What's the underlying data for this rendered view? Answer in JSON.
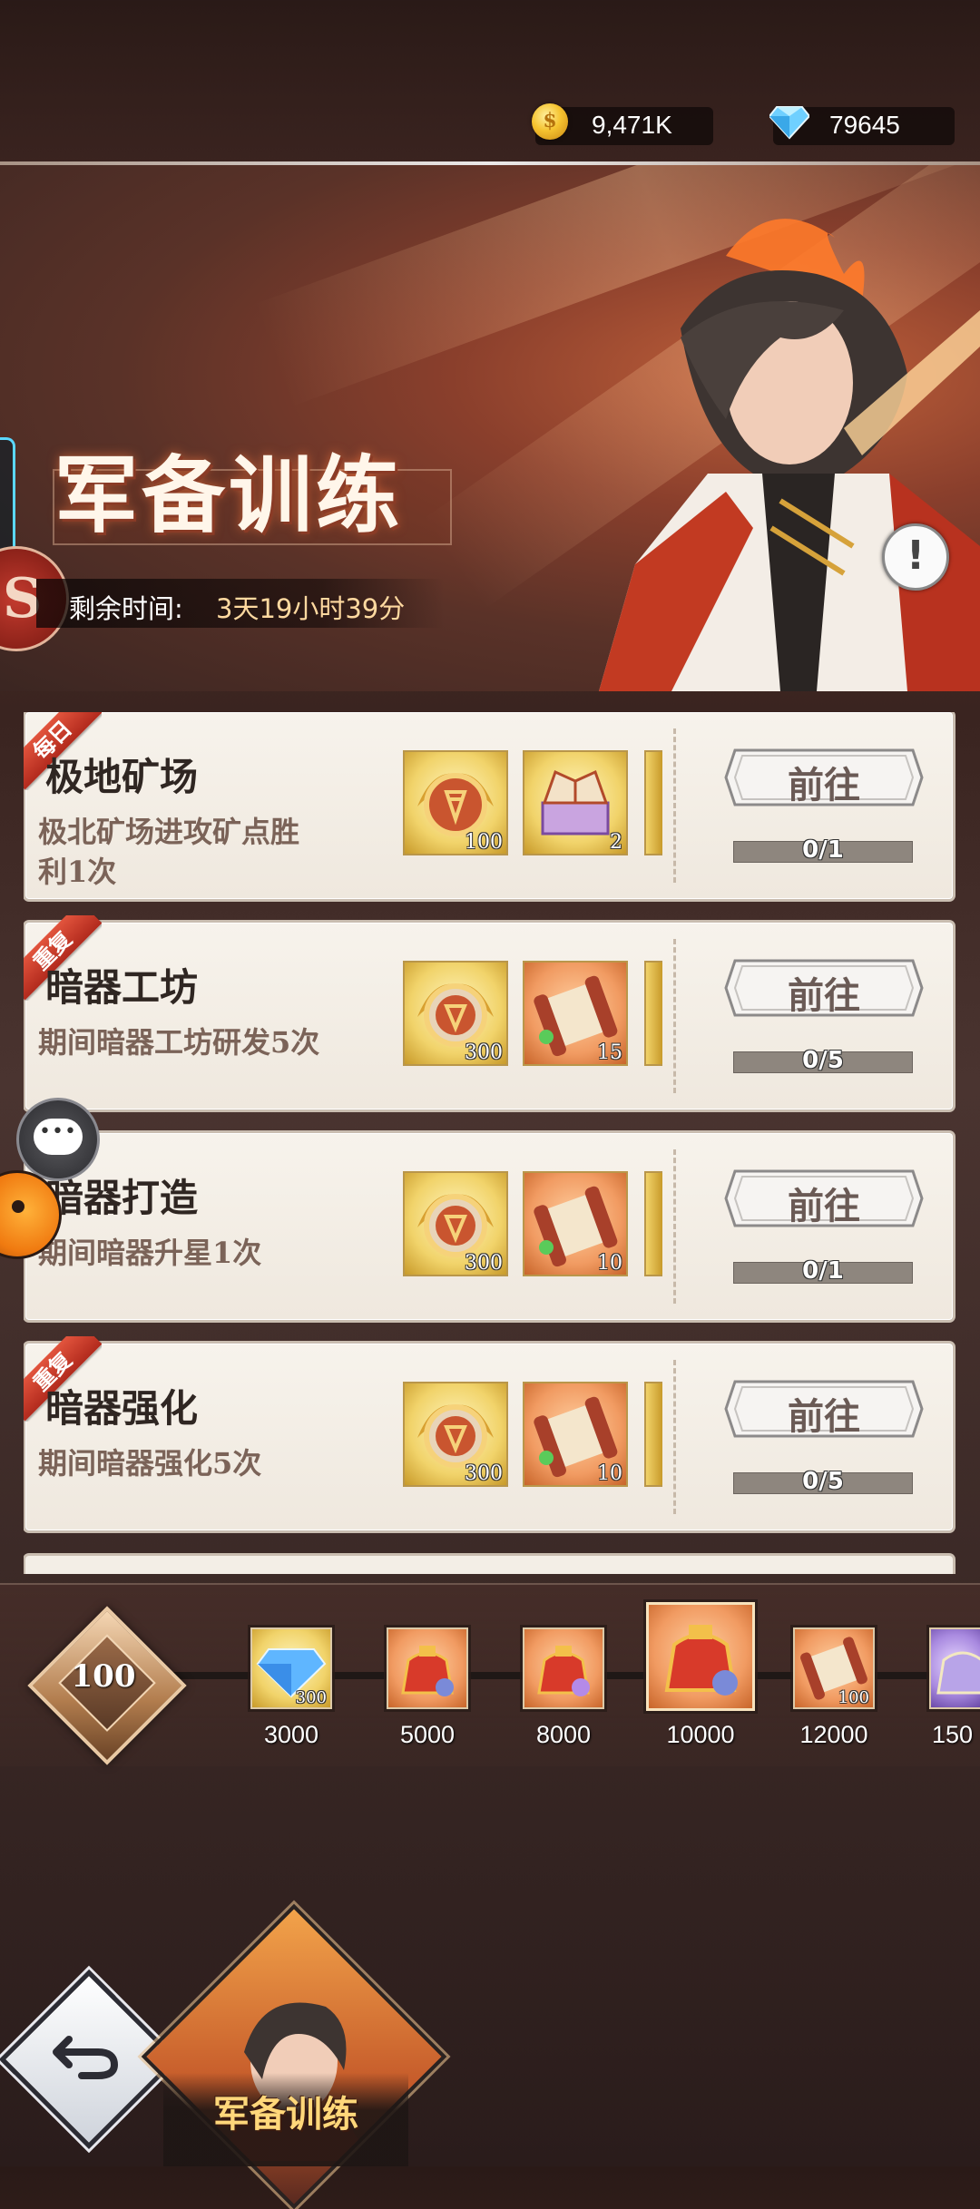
{
  "currency": {
    "gold": "9,471K",
    "gems": "79645",
    "gold_icon": "gold-coin-icon",
    "gem_icon": "diamond-icon"
  },
  "banner": {
    "title": "军备训练",
    "timer_label": "剩余时间:",
    "timer_value": "3天19小时39分",
    "info_icon": "exclamation-icon"
  },
  "tasks": [
    {
      "tag": "每日",
      "title": "极地矿场",
      "desc": "极北矿场进攻矿点胜利1次",
      "rewards": [
        {
          "icon": "medal-icon",
          "count": "100"
        },
        {
          "icon": "treasure-box-icon",
          "count": "2"
        }
      ],
      "button": "前往",
      "progress": "0/1",
      "progress_fraction": 0
    },
    {
      "tag": "重复",
      "title": "暗器工坊",
      "desc": "期间暗器工坊研发5次",
      "rewards": [
        {
          "icon": "medal-icon",
          "count": "300"
        },
        {
          "icon": "scroll-icon",
          "count": "15"
        }
      ],
      "button": "前往",
      "progress": "0/5",
      "progress_fraction": 0
    },
    {
      "tag": "",
      "title": "暗器打造",
      "desc": "期间暗器升星1次",
      "rewards": [
        {
          "icon": "medal-icon",
          "count": "300"
        },
        {
          "icon": "scroll-icon",
          "count": "10"
        }
      ],
      "button": "前往",
      "progress": "0/1",
      "progress_fraction": 0
    },
    {
      "tag": "重复",
      "title": "暗器强化",
      "desc": "期间暗器强化5次",
      "rewards": [
        {
          "icon": "medal-icon",
          "count": "300"
        },
        {
          "icon": "scroll-icon",
          "count": "10"
        }
      ],
      "button": "前往",
      "progress": "0/5",
      "progress_fraction": 0
    }
  ],
  "track": {
    "level": "100",
    "milestones": [
      {
        "label": "3000",
        "icon": "diamond-icon",
        "count": "300"
      },
      {
        "label": "5000",
        "icon": "gift-bag-icon",
        "count": ""
      },
      {
        "label": "8000",
        "icon": "gift-bag-icon",
        "count": ""
      },
      {
        "label": "10000",
        "icon": "gift-bag-icon",
        "count": ""
      },
      {
        "label": "12000",
        "icon": "scroll-icon",
        "count": "100"
      },
      {
        "label": "150",
        "icon": "purple-bag-icon",
        "count": ""
      }
    ]
  },
  "bottom": {
    "portrait_name": "军备训练",
    "back_icon": "back-arrow-icon"
  }
}
